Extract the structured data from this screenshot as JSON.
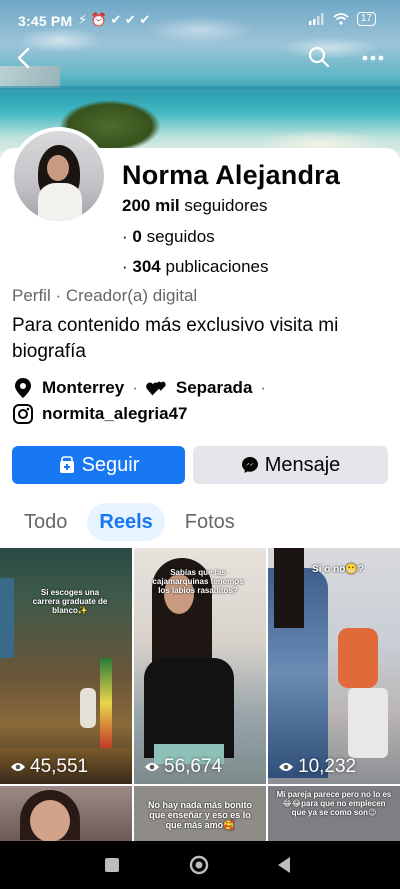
{
  "status_bar": {
    "time": "3:45 PM",
    "icons": "⚡ ⏰ ✔ ✔ ✔",
    "battery": "17"
  },
  "profile": {
    "name": "Norma Alejandra",
    "followers_count": "200 mil",
    "followers_label": "seguidores",
    "following_prefix": "· ",
    "following_count": "0",
    "following_label": "seguidos",
    "posts_prefix": "· ",
    "posts_count": "304",
    "posts_label": "publicaciones",
    "category": "Perfil · Creador(a) digital",
    "bio": "Para contenido más exclusivo visita mi biografía",
    "location": "Monterrey",
    "relationship": "Separada",
    "instagram": "normita_alegria47",
    "separator": "·"
  },
  "actions": {
    "follow_label": "Seguir",
    "message_label": "Mensaje"
  },
  "tabs": [
    {
      "label": "Todo",
      "active": false
    },
    {
      "label": "Reels",
      "active": true
    },
    {
      "label": "Fotos",
      "active": false
    }
  ],
  "reels": [
    {
      "caption": "Si escoges una carrera graduate de blanco✨",
      "views": "45,551"
    },
    {
      "caption": "Sabías que las cajamarquinas tenemos los labios rasaditos?",
      "views": "56,674"
    },
    {
      "caption": "Si o no😬?",
      "views": "10,232"
    },
    {
      "caption": "",
      "views": ""
    },
    {
      "caption": "No hay nada más bonito que enseñar y eso es lo que más amo🥰",
      "views": ""
    },
    {
      "caption": "Mi pareja parece pero no lo es😂😂para que no empiecen que ya se como son😉",
      "views": ""
    }
  ],
  "colors": {
    "accent": "#1877f2",
    "tab_active_bg": "#e7f3ff",
    "secondary_button": "#e4e6eb",
    "muted_text": "#65676b"
  }
}
